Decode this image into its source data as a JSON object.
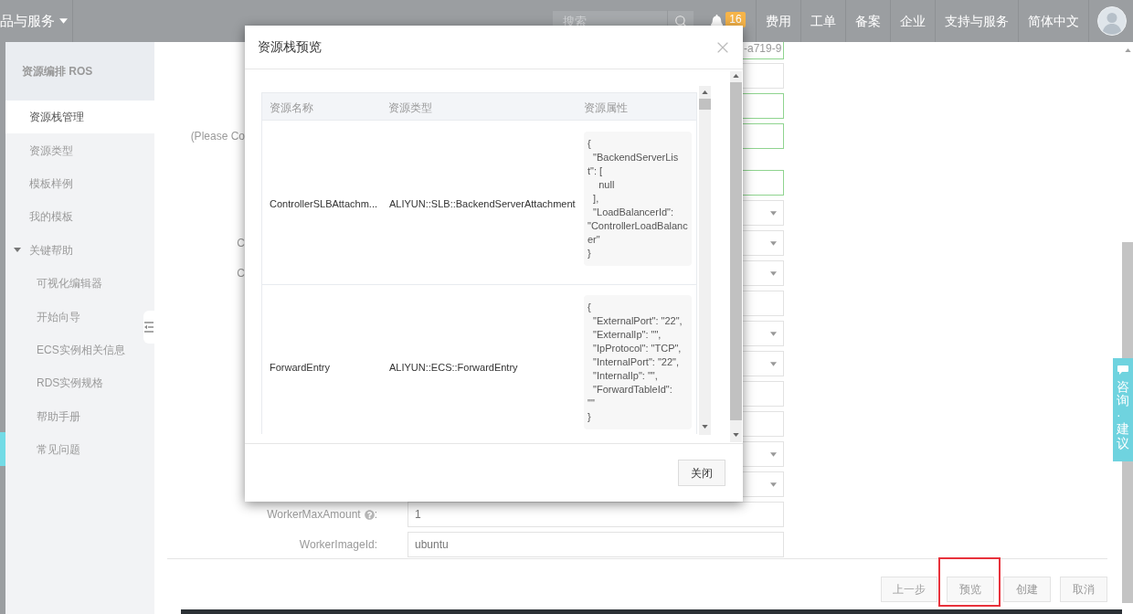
{
  "top_bar": {
    "products_menu": "品与服务",
    "search": {
      "placeholder": "搜索"
    },
    "notifications": {
      "count": "16"
    },
    "nav_items": [
      "费用",
      "工单",
      "备案",
      "企业",
      "支持与服务",
      "简体中文"
    ]
  },
  "sidebar": {
    "title": "资源编排 ROS",
    "items": [
      {
        "label": "资源栈管理",
        "selected": true
      },
      {
        "label": "资源类型",
        "selected": false
      },
      {
        "label": "模板样例",
        "selected": false
      },
      {
        "label": "我的模板",
        "selected": false
      },
      {
        "label": "关键帮助",
        "selected": false,
        "expanded": true,
        "children": [
          {
            "label": "可视化编辑器",
            "selected": false
          },
          {
            "label": "开始向导",
            "selected": false
          },
          {
            "label": "ECS实例相关信息",
            "selected": false
          },
          {
            "label": "RDS实例规格",
            "selected": false
          },
          {
            "label": "帮助手册",
            "selected": false
          },
          {
            "label": "常见问题",
            "selected": false
          }
        ]
      }
    ]
  },
  "form": {
    "rows_behind_dialog": [
      {
        "kind": "input",
        "valid": true,
        "value": "-a719-9"
      },
      {
        "kind": "input",
        "valid": false
      },
      {
        "kind": "input",
        "valid": true
      },
      {
        "kind": "input",
        "valid": true,
        "label": "(Please Co"
      },
      {
        "kind": "input",
        "valid": true
      },
      {
        "kind": "select"
      },
      {
        "kind": "select",
        "label": "C"
      },
      {
        "kind": "select",
        "label": "C"
      },
      {
        "kind": "input",
        "valid": false
      },
      {
        "kind": "select"
      },
      {
        "kind": "select"
      },
      {
        "kind": "input",
        "valid": false
      },
      {
        "kind": "input",
        "valid": false
      },
      {
        "kind": "select"
      },
      {
        "kind": "select"
      }
    ],
    "rows": [
      {
        "label": "WorkerMaxAmount",
        "help": true,
        "suffix": ":",
        "value": "1"
      },
      {
        "label": "WorkerImageId",
        "help": false,
        "suffix": ":",
        "value": "ubuntu"
      }
    ]
  },
  "footer_buttons": [
    {
      "label": "上一步",
      "annotated": false
    },
    {
      "label": "预览",
      "annotated": true
    },
    {
      "label": "创建",
      "annotated": false
    },
    {
      "label": "取消",
      "annotated": false
    }
  ],
  "dialog": {
    "title": "资源栈预览",
    "table": {
      "columns": [
        "资源名称",
        "资源类型",
        "资源属性"
      ],
      "rows": [
        {
          "name": "ControllerSLBAttachm...",
          "type": "ALIYUN::SLB::BackendServerAttachment",
          "properties": "{\n  \"BackendServerLis\nt\": [\n    null\n  ],\n  \"LoadBalancerId\":\n\"ControllerLoadBalanc\ner\"\n}"
        },
        {
          "name": "ForwardEntry",
          "type": "ALIYUN::ECS::ForwardEntry",
          "properties": "{\n  \"ExternalPort\": \"22\",\n  \"ExternalIp\": \"\",\n  \"IpProtocol\": \"TCP\",\n  \"InternalPort\": \"22\",\n  \"InternalIp\": \"\",\n  \"ForwardTableId\":\n\"\"\n}"
        }
      ]
    },
    "buttons": [
      "关闭"
    ]
  },
  "feedback_tab": "咨询·建议"
}
